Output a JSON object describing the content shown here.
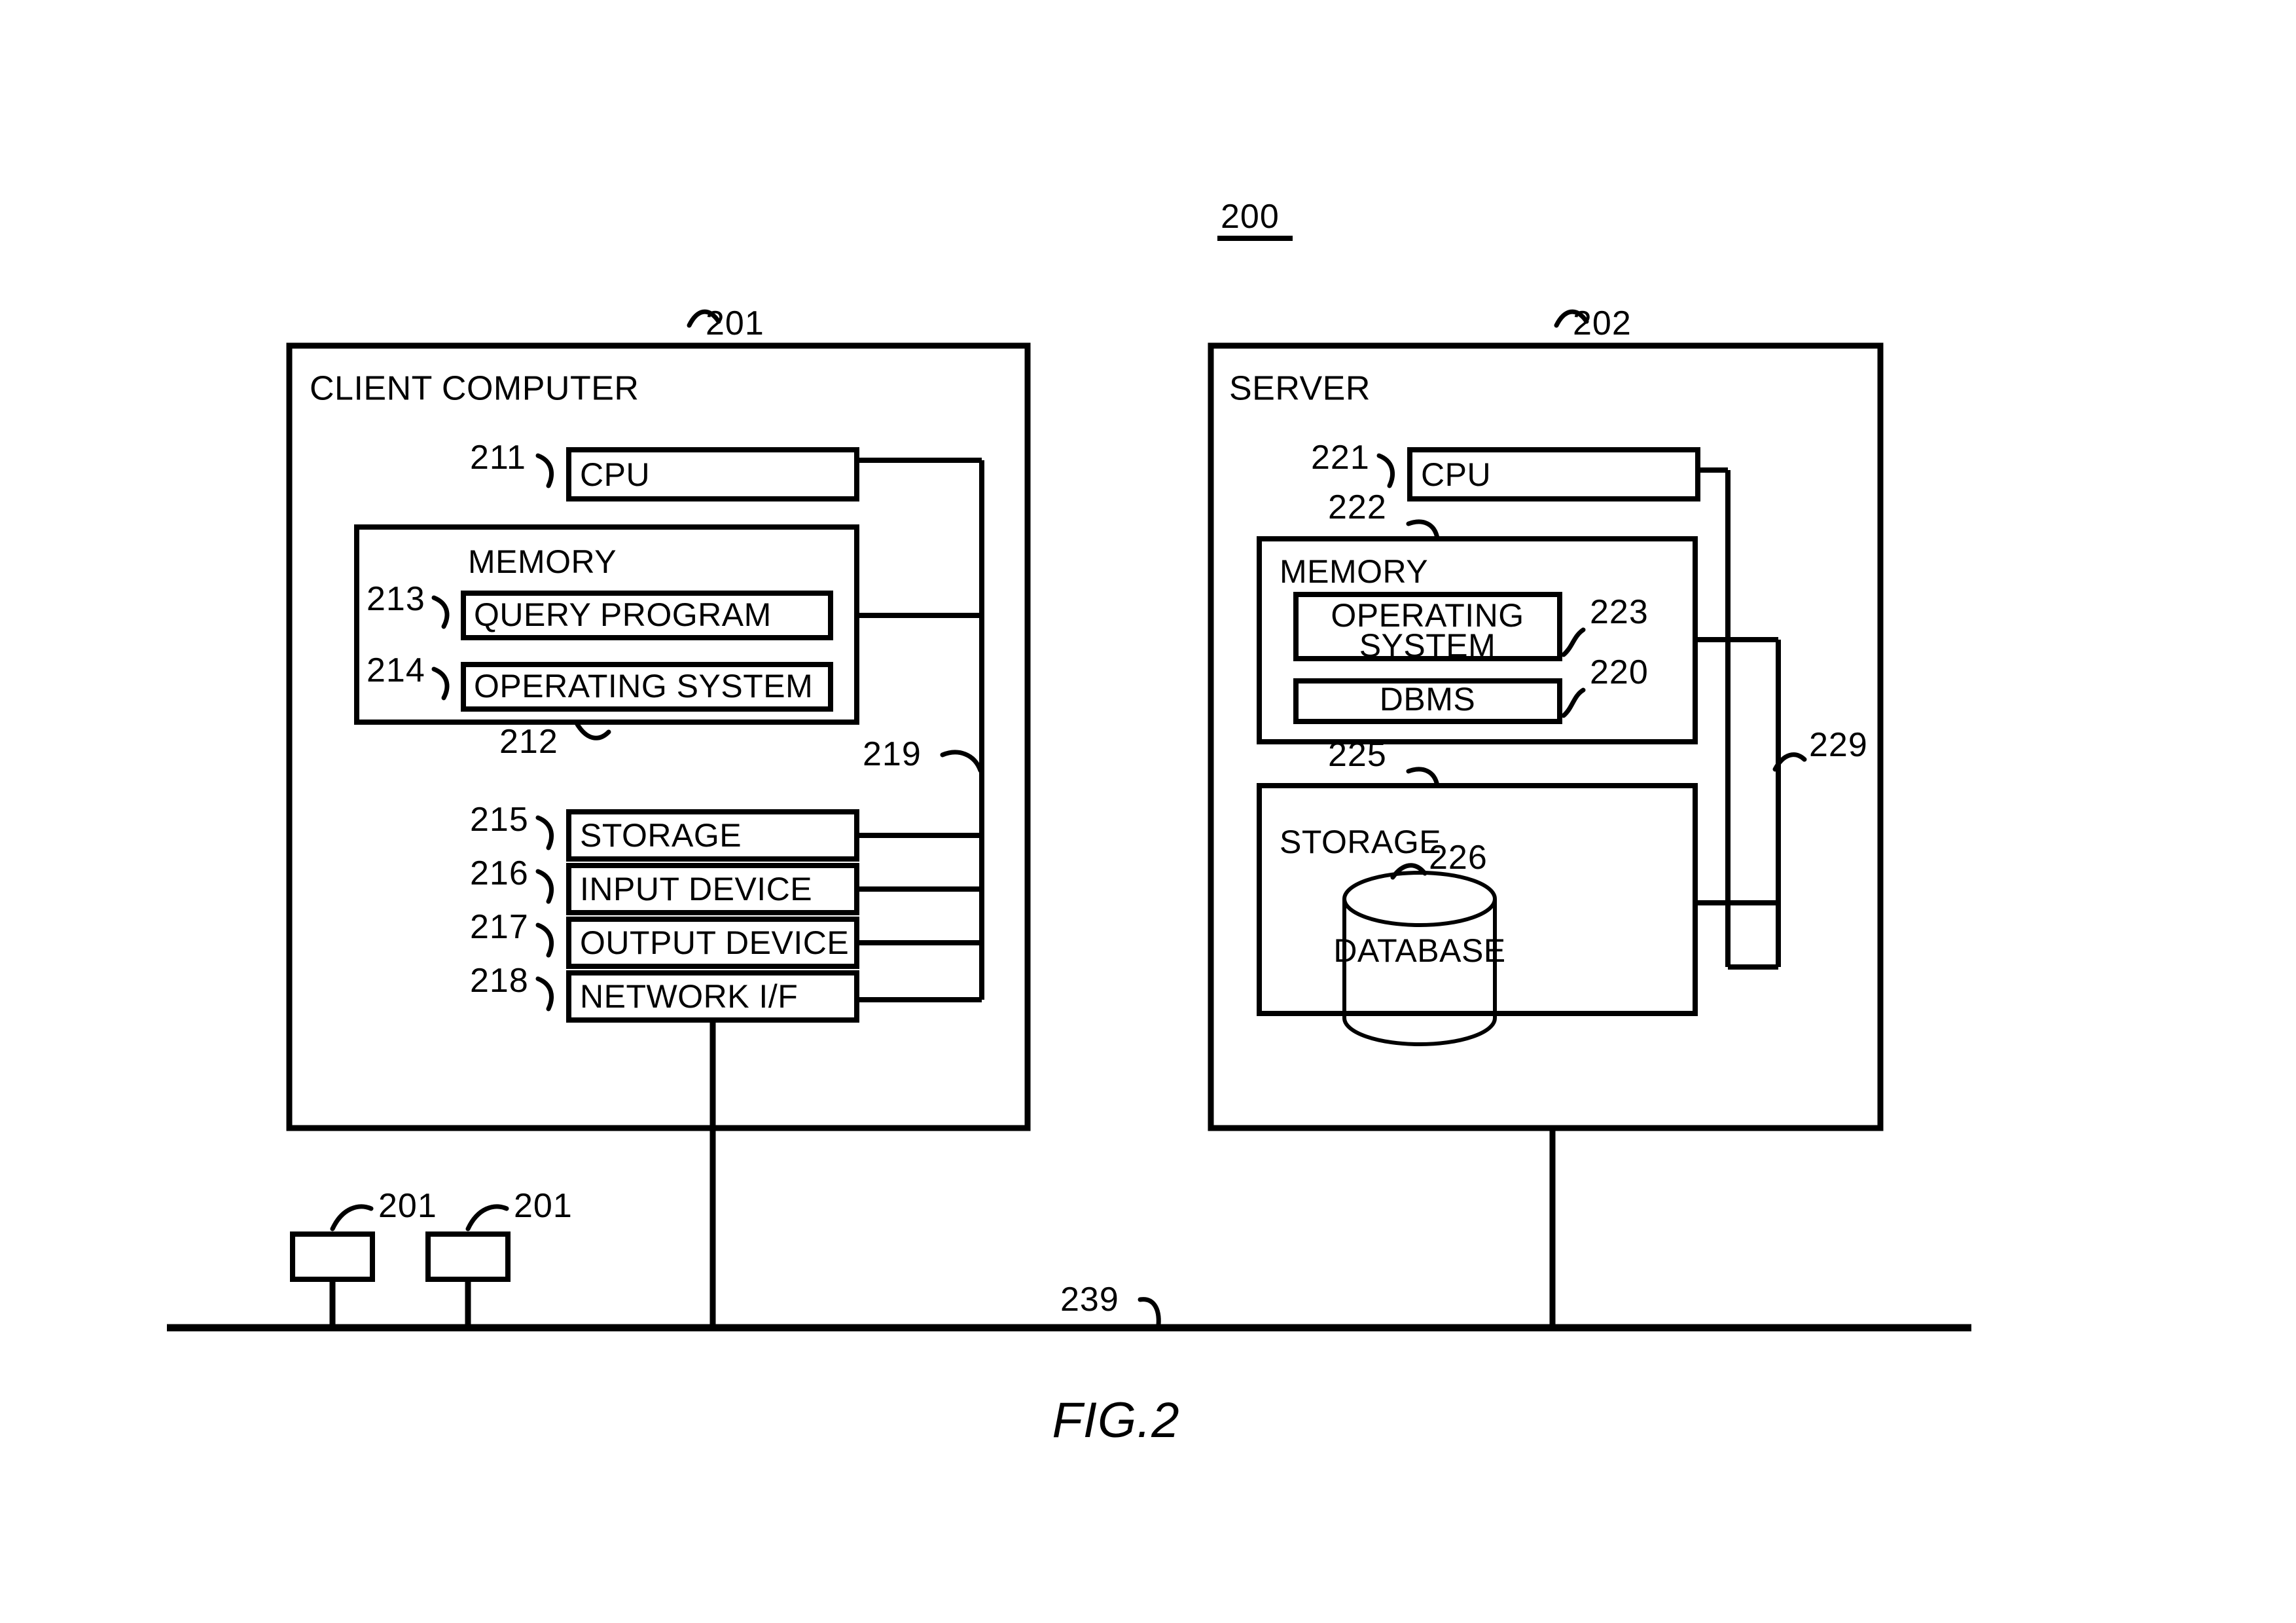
{
  "figure": {
    "caption": "FIG.2",
    "system_ref": "200"
  },
  "client": {
    "title": "CLIENT COMPUTER",
    "ref": "201",
    "cpu": {
      "label": "CPU",
      "ref": "211"
    },
    "memory": {
      "label": "MEMORY",
      "ref": "212",
      "items": [
        {
          "label": "QUERY PROGRAM",
          "ref": "213"
        },
        {
          "label": "OPERATING SYSTEM",
          "ref": "214"
        }
      ]
    },
    "peripherals": [
      {
        "label": "STORAGE",
        "ref": "215"
      },
      {
        "label": "INPUT DEVICE",
        "ref": "216"
      },
      {
        "label": "OUTPUT DEVICE",
        "ref": "217"
      },
      {
        "label": "NETWORK I/F",
        "ref": "218"
      }
    ],
    "bus_ref": "219"
  },
  "server": {
    "title": "SERVER",
    "ref": "202",
    "cpu": {
      "label": "CPU",
      "ref": "221"
    },
    "memory": {
      "label": "MEMORY",
      "ref": "222",
      "items": [
        {
          "label_line1": "OPERATING",
          "label_line2": "SYSTEM",
          "ref": "223"
        },
        {
          "label": "DBMS",
          "ref": "220"
        }
      ]
    },
    "storage": {
      "label": "STORAGE",
      "ref": "225",
      "database": {
        "label": "DATABASE",
        "ref": "226"
      }
    },
    "bus_ref": "229"
  },
  "network": {
    "ref": "239",
    "extra_clients": [
      {
        "ref": "201"
      },
      {
        "ref": "201"
      }
    ]
  },
  "colors": {
    "ink": "#000000",
    "paper": "#ffffff"
  }
}
